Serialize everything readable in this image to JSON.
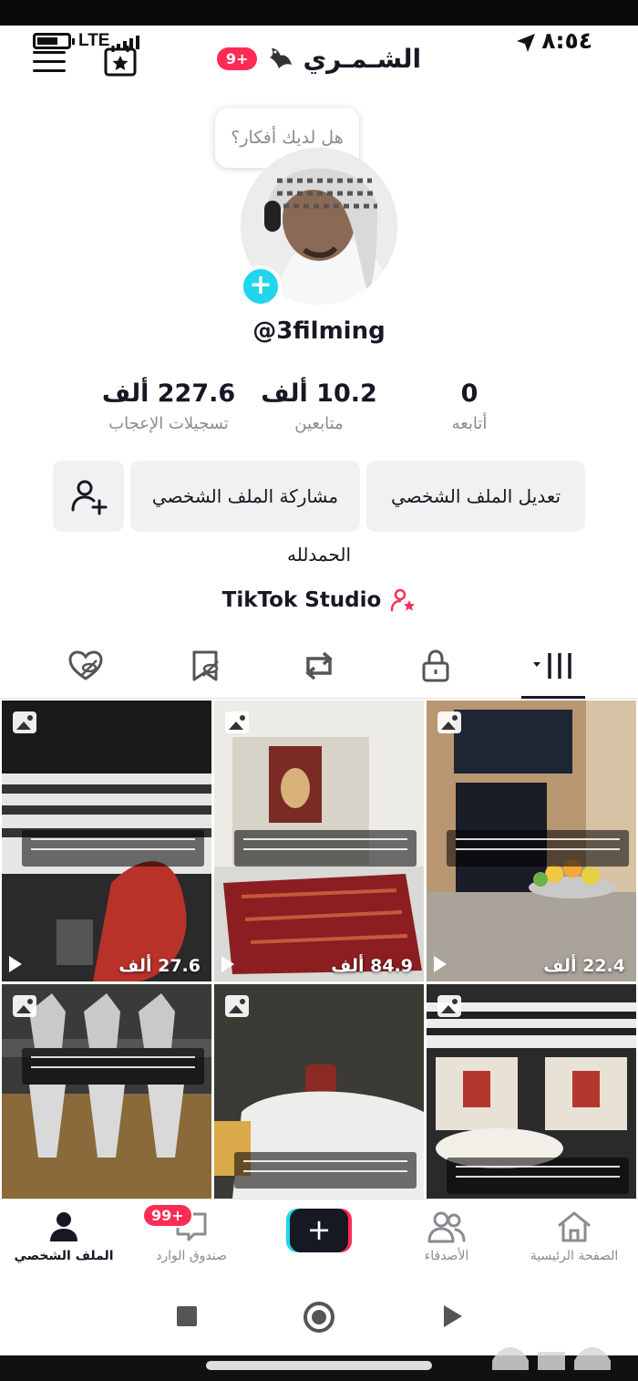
{
  "status_bar": {
    "time": "٨:٥٤",
    "network": "LTE"
  },
  "header": {
    "name": "الشـمـري",
    "notification_badge": "9+"
  },
  "bubble": {
    "text": "هل لديك أفكار؟"
  },
  "profile": {
    "username": "@3filming",
    "bio": "الحمدلله",
    "studio_link": "TikTok Studio"
  },
  "stats": {
    "likes": {
      "value": "227.6 ألف",
      "label": "تسجيلات الإعجاب"
    },
    "followers": {
      "value": "10.2 ألف",
      "label": "متابعين"
    },
    "following": {
      "value": "0",
      "label": "أتابعه"
    }
  },
  "buttons": {
    "edit_profile": "تعديل الملف الشخصي",
    "share_profile": "مشاركة الملف الشخصي"
  },
  "tabs": {
    "items": [
      "videos-grid",
      "private-lock",
      "reposts",
      "favorites",
      "liked"
    ],
    "active": "videos-grid"
  },
  "videos": [
    {
      "views": "27.6 ألف"
    },
    {
      "views": "84.9 ألف"
    },
    {
      "views": "22.4 ألف"
    },
    {
      "views": ""
    },
    {
      "views": ""
    },
    {
      "views": ""
    }
  ],
  "bottom_nav": {
    "profile": "الملف الشخصي",
    "inbox": "صندوق الوارد",
    "inbox_badge": "99+",
    "friends": "الأصدقاء",
    "home": "الصفحة الرئيسية"
  },
  "colors": {
    "accent_red": "#fe2c55",
    "accent_cyan": "#20d5ec",
    "text_primary": "#161823",
    "text_secondary": "#8a8b91"
  }
}
